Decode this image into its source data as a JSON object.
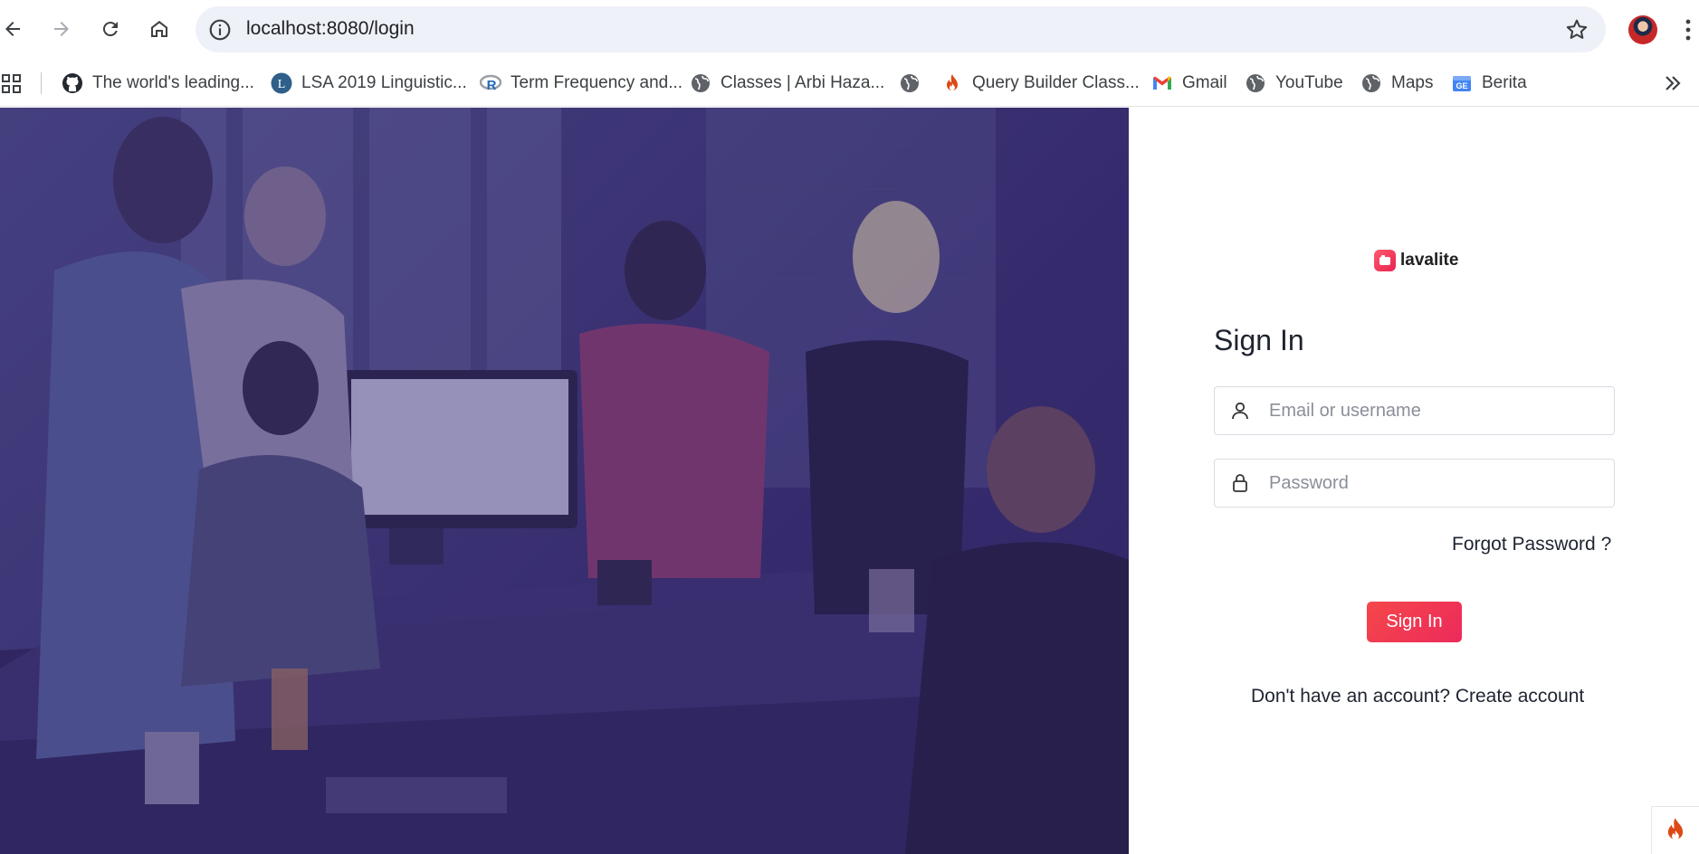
{
  "browser": {
    "url": "localhost:8080/login",
    "bookmarks": [
      {
        "label": "The world's leading...",
        "icon": "github-icon"
      },
      {
        "label": "LSA 2019 Linguistic...",
        "icon": "lsa-icon"
      },
      {
        "label": "Term Frequency and...",
        "icon": "r-icon"
      },
      {
        "label": "Classes | Arbi Haza...",
        "icon": "globe-icon"
      },
      {
        "label": "",
        "icon": "globe-icon"
      },
      {
        "label": "Query Builder Class...",
        "icon": "flame-icon"
      },
      {
        "label": "Gmail",
        "icon": "gmail-icon"
      },
      {
        "label": "YouTube",
        "icon": "globe-icon"
      },
      {
        "label": "Maps",
        "icon": "globe-icon"
      },
      {
        "label": "Berita",
        "icon": "news-icon"
      }
    ]
  },
  "login": {
    "brand": "lavalite",
    "title": "Sign In",
    "email_placeholder": "Email or username",
    "password_placeholder": "Password",
    "forgot_label": "Forgot Password ?",
    "submit_label": "Sign In",
    "signup_prompt": "Don't have an account? Create account"
  },
  "colors": {
    "accent": "#ef3556",
    "hero_overlay": "#3a2e72"
  }
}
